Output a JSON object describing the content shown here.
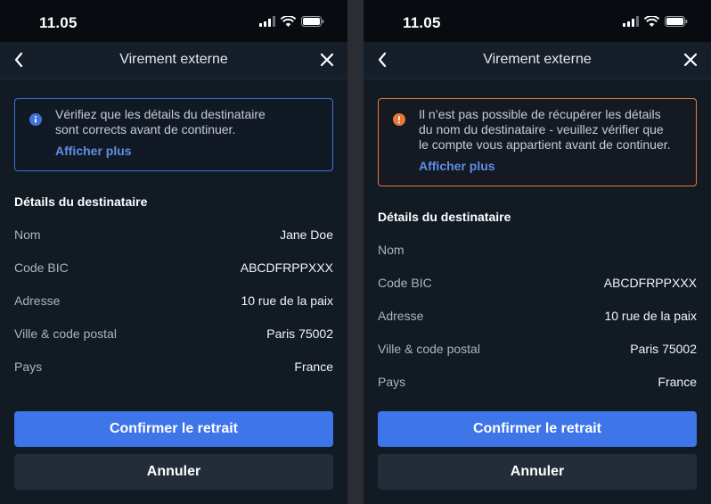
{
  "colors": {
    "accent": "#3e75e8",
    "info": "#3f73d8",
    "warning": "#e5793a",
    "background": "#121a24",
    "link": "#5e8ee6"
  },
  "screens": [
    {
      "status_bar": {
        "time": "11.05"
      },
      "nav": {
        "title": "Virement externe",
        "back_icon": "chevron-left-icon",
        "close_icon": "close-icon"
      },
      "alert": {
        "type": "info",
        "icon": "info-icon",
        "text_lines": [
          "Vérifiez que les détails du destinataire",
          "sont corrects avant de continuer."
        ],
        "link": "Afficher plus"
      },
      "details": {
        "title": "Détails du destinataire",
        "rows": [
          {
            "label": "Nom",
            "value": "Jane Doe"
          },
          {
            "label": "Code BIC",
            "value": "ABCDFRPPXXX"
          },
          {
            "label": "Adresse",
            "value": "10 rue de la paix"
          },
          {
            "label": "Ville & code postal",
            "value": "Paris 75002"
          },
          {
            "label": "Pays",
            "value": "France"
          }
        ]
      },
      "buttons": {
        "confirm": "Confirmer le retrait",
        "cancel": "Annuler"
      }
    },
    {
      "status_bar": {
        "time": "11.05"
      },
      "nav": {
        "title": "Virement externe",
        "back_icon": "chevron-left-icon",
        "close_icon": "close-icon"
      },
      "alert": {
        "type": "warning",
        "icon": "warning-icon",
        "text_lines": [
          "Il n’est pas possible de récupérer les détails",
          "du nom du destinataire - veuillez vérifier que",
          "le compte vous appartient avant de continuer."
        ],
        "link": "Afficher plus"
      },
      "details": {
        "title": "Détails du destinataire",
        "rows": [
          {
            "label": "Nom",
            "value": ""
          },
          {
            "label": "Code BIC",
            "value": "ABCDFRPPXXX"
          },
          {
            "label": "Adresse",
            "value": "10 rue de la paix"
          },
          {
            "label": "Ville & code postal",
            "value": "Paris 75002"
          },
          {
            "label": "Pays",
            "value": "France"
          }
        ]
      },
      "buttons": {
        "confirm": "Confirmer le retrait",
        "cancel": "Annuler"
      }
    }
  ]
}
